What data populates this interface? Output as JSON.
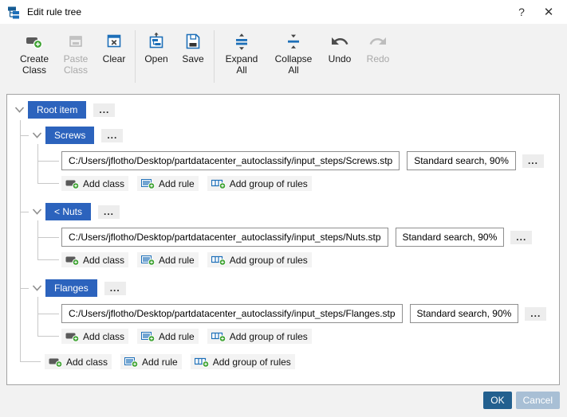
{
  "window": {
    "title": "Edit rule tree",
    "help_label": "?",
    "close_label": "✕"
  },
  "toolbar": {
    "buttons": [
      {
        "label": "Create Class",
        "icon": "class-plus-icon",
        "enabled": true
      },
      {
        "label": "Paste Class",
        "icon": "paste-class-icon",
        "enabled": false
      },
      {
        "label": "Clear",
        "icon": "clear-icon",
        "enabled": true
      },
      {
        "label": "Open",
        "icon": "open-icon",
        "enabled": true
      },
      {
        "label": "Save",
        "icon": "save-icon",
        "enabled": true
      },
      {
        "label": "Expand All",
        "icon": "expand-all-icon",
        "enabled": true
      },
      {
        "label": "Collapse All",
        "icon": "collapse-all-icon",
        "enabled": true
      },
      {
        "label": "Undo",
        "icon": "undo-icon",
        "enabled": true
      },
      {
        "label": "Redo",
        "icon": "redo-icon",
        "enabled": false
      }
    ]
  },
  "tree": {
    "root": {
      "label": "Root item",
      "more_label": "..."
    },
    "classes": [
      {
        "label": "Screws",
        "path": "C:/Users/jflotho/Desktop/partdatacenter_autoclassify/input_steps/Screws.stp",
        "search": "Standard search, 90%",
        "more_label": "..."
      },
      {
        "label": "< Nuts",
        "path": "C:/Users/jflotho/Desktop/partdatacenter_autoclassify/input_steps/Nuts.stp",
        "search": "Standard search, 90%",
        "more_label": "..."
      },
      {
        "label": "Flanges",
        "path": "C:/Users/jflotho/Desktop/partdatacenter_autoclassify/input_steps/Flanges.stp",
        "search": "Standard search, 90%",
        "more_label": "..."
      }
    ],
    "actions": {
      "add_class": "Add class",
      "add_rule": "Add rule",
      "add_group": "Add group of rules"
    }
  },
  "footer": {
    "ok_label": "OK",
    "cancel_label": "Cancel"
  },
  "colors": {
    "node_blue": "#2c63bd",
    "ok_blue": "#23608f",
    "cancel_blue": "#a8bfd5",
    "icon_blue": "#1d6fb8",
    "icon_green": "#3ea232"
  }
}
